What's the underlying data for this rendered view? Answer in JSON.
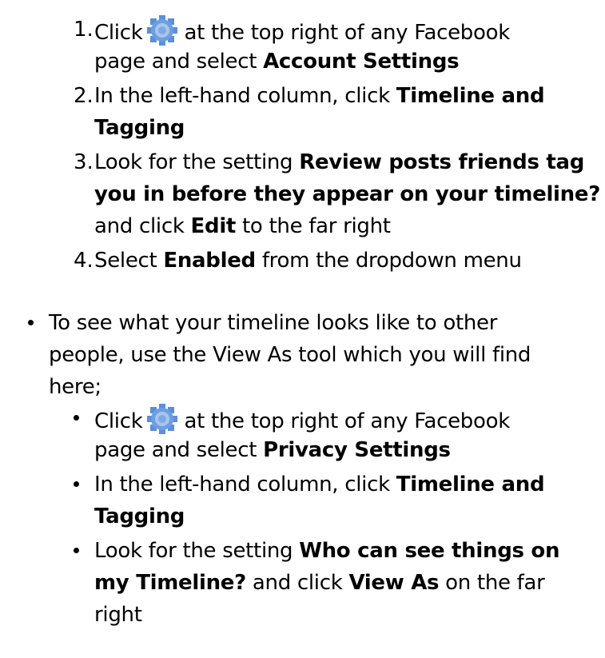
{
  "numbered_steps": [
    {
      "num": "1.",
      "line1_a": "Click",
      "line1_icon": "gear-icon",
      "line1_b": "at the top right of any Facebook",
      "line2_a": "page and select ",
      "line2_b": "Account Settings"
    },
    {
      "num": "2.",
      "line1_a": "In the left-hand column, click ",
      "line1_b": "Timeline and",
      "line2_b": "Tagging"
    },
    {
      "num": "3.",
      "line1_a": "Look for the setting ",
      "line1_b": "Review posts friends tag",
      "line2_b": "you in before they appear on your timeline?",
      "line3_a": "and click ",
      "line3_b": "Edit",
      "line3_c": " to the far right"
    },
    {
      "num": "4.",
      "line1_a": "Select ",
      "line1_b": "Enabled",
      "line1_c": " from the dropdown menu"
    }
  ],
  "bullet_section": {
    "intro_line1": "To see what your timeline looks like to other",
    "intro_line2": "people, use the View As tool which you will find",
    "intro_line3": "here;",
    "items": [
      {
        "line1_a": "Click",
        "line1_icon": "gear-icon",
        "line1_b": "at the top right of any Facebook",
        "line2_a": "page and select ",
        "line2_b": "Privacy Settings"
      },
      {
        "line1_a": "In the left-hand column, click ",
        "line1_b": "Timeline and",
        "line2_b": "Tagging"
      },
      {
        "line1_a": "Look for the setting ",
        "line1_b": "Who can see things on",
        "line2_b": "my Timeline?",
        "line2_c": " and click ",
        "line2_d": "View As",
        "line2_e": " on the far",
        "line3_a": "right"
      }
    ]
  },
  "colors": {
    "gear_blue": "#5b8fd6",
    "gear_light": "#a9c6ee",
    "text": "#000000"
  }
}
